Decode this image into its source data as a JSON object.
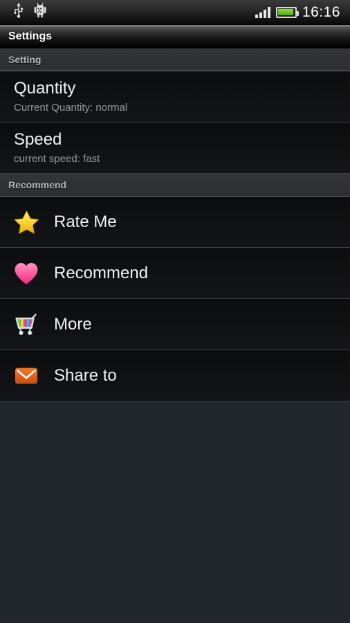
{
  "status_bar": {
    "icons": [
      "usb-icon",
      "android-debug-icon"
    ],
    "signal_bars": 4,
    "battery_level_icon": "battery-full-icon",
    "time": "16:16"
  },
  "title_bar": {
    "title": "Settings"
  },
  "sections": [
    {
      "header": "Setting",
      "items": [
        {
          "type": "two-line",
          "name": "quantity",
          "title": "Quantity",
          "summary": "Current Quantity: normal"
        },
        {
          "type": "two-line",
          "name": "speed",
          "title": "Speed",
          "summary": "current speed: fast"
        }
      ]
    },
    {
      "header": "Recommend",
      "items": [
        {
          "type": "icon",
          "name": "rate-me",
          "icon": "star-icon",
          "label": "Rate Me"
        },
        {
          "type": "icon",
          "name": "recommend",
          "icon": "heart-icon",
          "label": "Recommend"
        },
        {
          "type": "icon",
          "name": "more",
          "icon": "shopping-cart-icon",
          "label": "More"
        },
        {
          "type": "icon",
          "name": "share-to",
          "icon": "mail-envelope-icon",
          "label": "Share to"
        }
      ]
    }
  ],
  "colors": {
    "background": "#22262d",
    "row_background": "#0c0d0f",
    "divider": "#3c3f44",
    "section_header_bg": "#2f3134",
    "section_header_text": "#b6b6b6",
    "primary_text": "#f2f2f2",
    "secondary_text": "#9a9a9a",
    "star": "#f7d13a",
    "heart": "#fb5ca0",
    "mail": "#e2631b",
    "battery_green": "#6fc41c"
  }
}
